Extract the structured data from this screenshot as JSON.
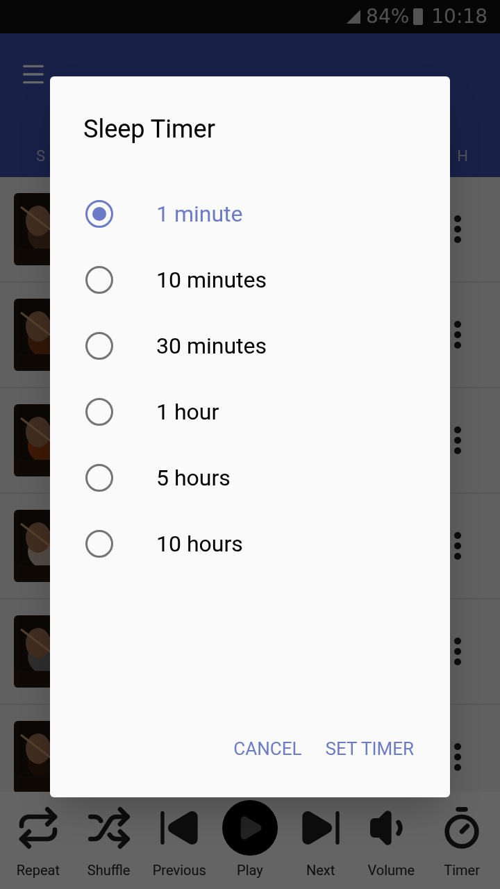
{
  "status_bar": {
    "battery": "84%",
    "time": "10:18"
  },
  "app_bar": {
    "tabs": [
      {
        "label": "S"
      },
      {
        "label": "H"
      }
    ]
  },
  "controls": [
    {
      "kind": "repeat",
      "label": "Repeat"
    },
    {
      "kind": "shuffle",
      "label": "Shuffle"
    },
    {
      "kind": "previous",
      "label": "Previous"
    },
    {
      "kind": "play",
      "label": "Play"
    },
    {
      "kind": "next",
      "label": "Next"
    },
    {
      "kind": "volume",
      "label": "Volume"
    },
    {
      "kind": "timer",
      "label": "Timer"
    }
  ],
  "dialog": {
    "title": "Sleep Timer",
    "options": [
      {
        "label": "1 minute",
        "selected": true
      },
      {
        "label": "10 minutes",
        "selected": false
      },
      {
        "label": "30 minutes",
        "selected": false
      },
      {
        "label": "1 hour",
        "selected": false
      },
      {
        "label": "5 hours",
        "selected": false
      },
      {
        "label": "10 hours",
        "selected": false
      }
    ],
    "buttons": [
      "CANCEL",
      "SET TIMER"
    ]
  }
}
